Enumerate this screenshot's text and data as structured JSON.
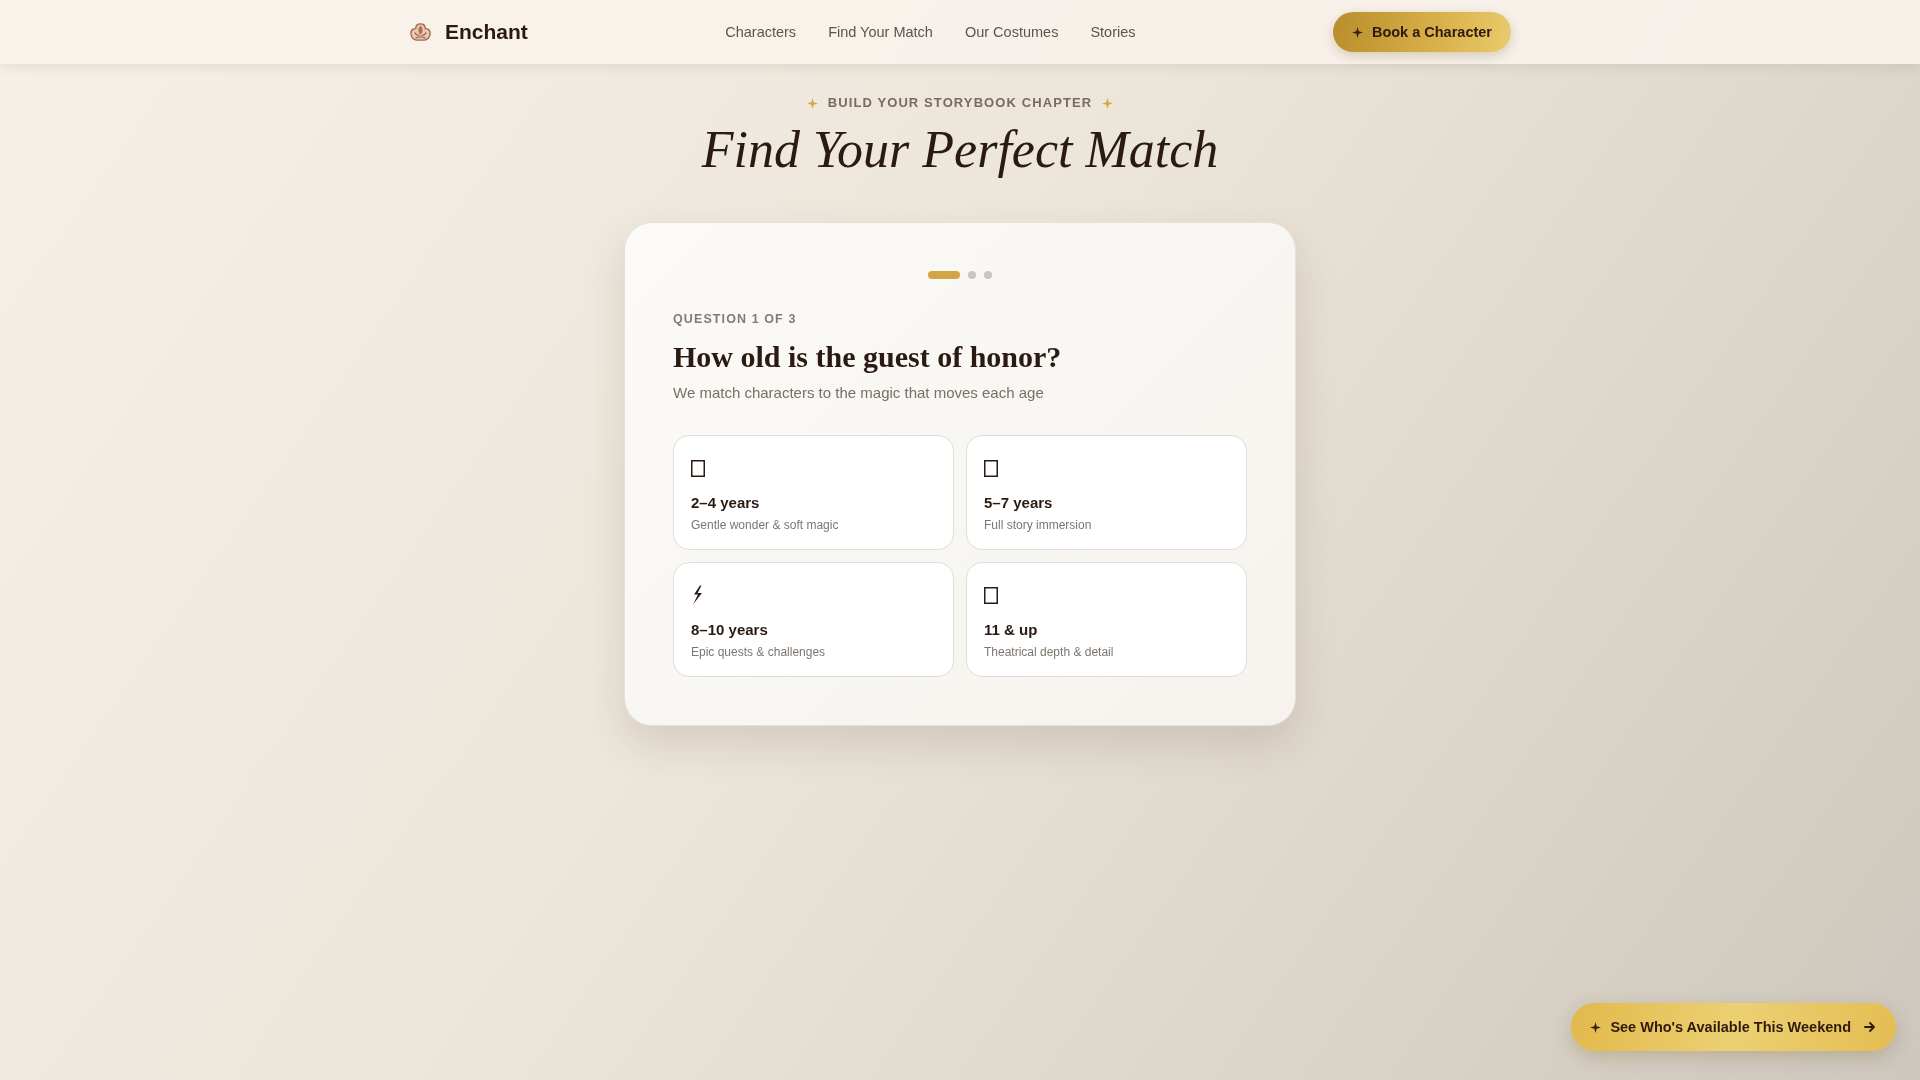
{
  "header": {
    "brand": "Enchant",
    "nav": [
      "Characters",
      "Find Your Match",
      "Our Costumes",
      "Stories"
    ],
    "cta": "Book a Character"
  },
  "hero": {
    "eyebrow": "BUILD YOUR STORYBOOK CHAPTER",
    "title": "Find Your Perfect Match"
  },
  "quiz": {
    "steps": [
      {
        "current": true
      },
      {
        "current": false
      },
      {
        "current": false
      }
    ],
    "counter": "QUESTION 1 OF 3",
    "question": "How old is the guest of honor?",
    "hint": "We match characters to the magic that moves each age",
    "options": [
      {
        "kind": "box",
        "label": "2–4 years",
        "description": "Gentle wonder & soft magic",
        "selected": false
      },
      {
        "kind": "box",
        "label": "5–7 years",
        "description": "Full story immersion",
        "selected": false
      },
      {
        "kind": "bolt",
        "label": "8–10 years",
        "description": "Epic quests & challenges",
        "selected": false
      },
      {
        "kind": "box",
        "label": "11 & up",
        "description": "Theatrical depth & detail",
        "selected": false
      }
    ]
  },
  "floating_button": {
    "label": "See Who's Available This Weekend"
  }
}
